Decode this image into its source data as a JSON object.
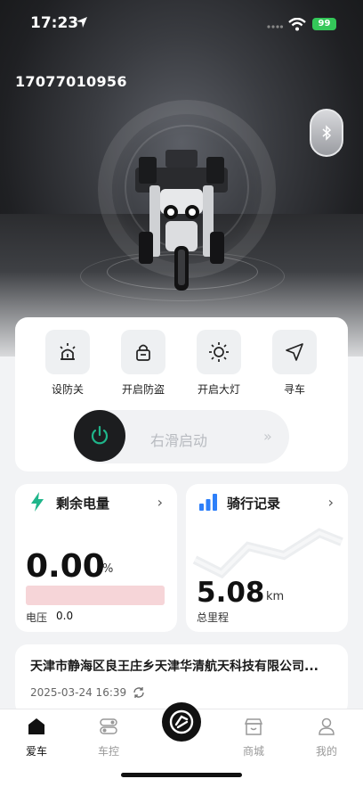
{
  "status_bar": {
    "time": "17:23",
    "battery": "99"
  },
  "hero": {
    "phone": "17077010956",
    "bluetooth_icon": "bluetooth-icon"
  },
  "controls": [
    {
      "label": "设防关",
      "icon": "alarm-light-icon"
    },
    {
      "label": "开启防盗",
      "icon": "lock-icon"
    },
    {
      "label": "开启大灯",
      "icon": "headlight-sun-icon"
    },
    {
      "label": "寻车",
      "icon": "navigation-arrow-icon"
    }
  ],
  "slider": {
    "label": "右滑启动",
    "chevron": "»"
  },
  "battery_card": {
    "title": "剩余电量",
    "value": "0.00",
    "unit": "%",
    "level": 0,
    "voltage_label": "电压",
    "voltage_value": "0.0"
  },
  "ride_card": {
    "title": "骑行记录",
    "value": "5.08",
    "unit": "km",
    "sub_label": "总里程"
  },
  "location": {
    "address": "天津市静海区良王庄乡天津华清航天科技有限公司...",
    "time": "2025-03-24 16:39"
  },
  "tabs": [
    {
      "label": "爱车",
      "active": true
    },
    {
      "label": "车控",
      "active": false
    },
    {
      "label": "商城",
      "active": false
    },
    {
      "label": "我的",
      "active": false
    }
  ],
  "colors": {
    "accent_green": "#1fb58a",
    "accent_blue": "#2d7ff9",
    "battery_bar": "#f6d5d8"
  }
}
